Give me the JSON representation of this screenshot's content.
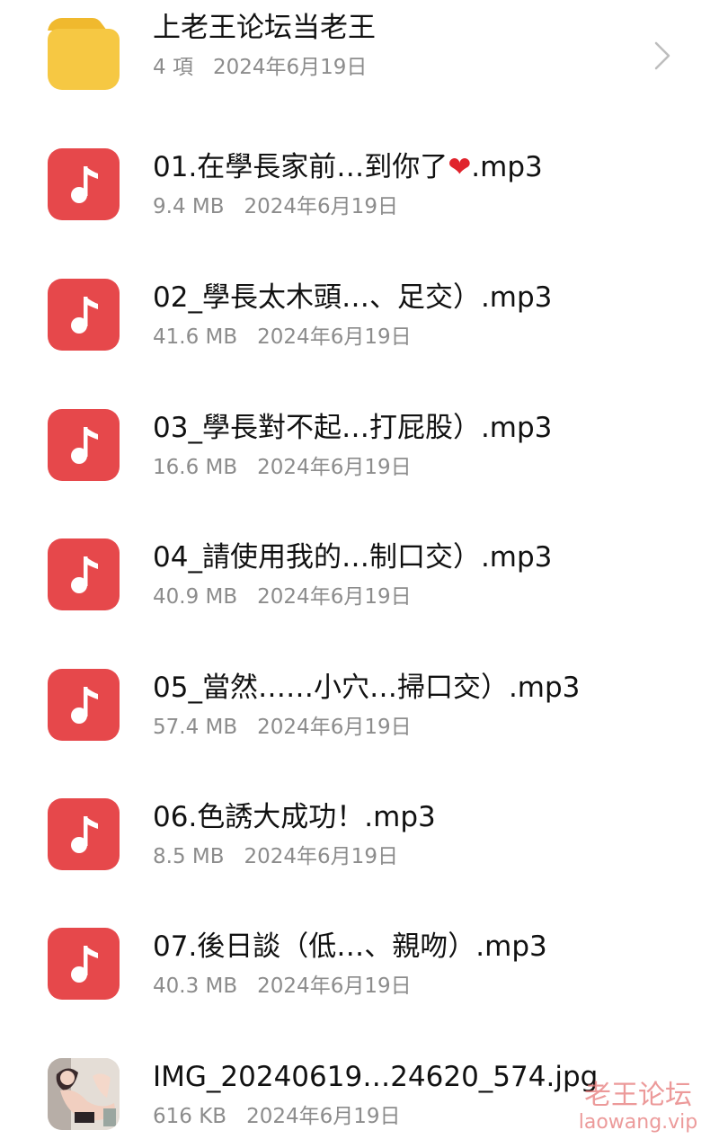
{
  "folder": {
    "name": "上老王论坛当老王",
    "count": "4 項",
    "date": "2024年6月19日",
    "icon": "folder-icon",
    "color": "#f5c842"
  },
  "files": [
    {
      "name_a": "01.在學長家前…到你了",
      "heart": "❤",
      "name_b": ".mp3",
      "size": "9.4 MB",
      "date": "2024年6月19日",
      "icon": "music-note-icon"
    },
    {
      "name": "02_學長太木頭…、足交）.mp3",
      "size": "41.6 MB",
      "date": "2024年6月19日",
      "icon": "music-note-icon"
    },
    {
      "name": "03_學長對不起…打屁股）.mp3",
      "size": "16.6 MB",
      "date": "2024年6月19日",
      "icon": "music-note-icon"
    },
    {
      "name": "04_請使用我的…制口交）.mp3",
      "size": "40.9 MB",
      "date": "2024年6月19日",
      "icon": "music-note-icon"
    },
    {
      "name": "05_當然……小穴…掃口交）.mp3",
      "size": "57.4 MB",
      "date": "2024年6月19日",
      "icon": "music-note-icon"
    },
    {
      "name": "06.色誘大成功！.mp3",
      "size": "8.5 MB",
      "date": "2024年6月19日",
      "icon": "music-note-icon"
    },
    {
      "name": "07.後日談（低…、親吻）.mp3",
      "size": "40.3 MB",
      "date": "2024年6月19日",
      "icon": "music-note-icon"
    },
    {
      "name": "IMG_20240619…24620_574.jpg",
      "size": "616 KB",
      "date": "2024年6月19日",
      "icon": "image-thumbnail-icon"
    }
  ],
  "watermark": {
    "cn": "老王论坛",
    "en": "laowang.vip"
  },
  "colors": {
    "music_icon": "#e6484b",
    "meta_text": "#8c8c8c",
    "title_text": "#111111"
  }
}
